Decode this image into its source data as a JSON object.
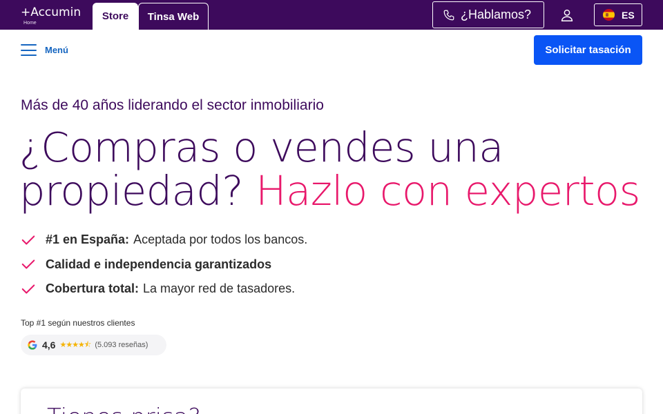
{
  "brand": {
    "logo": "+Accumin",
    "sub": "Home"
  },
  "tabs": [
    {
      "label": "Store",
      "active": true
    },
    {
      "label": "Tinsa Web",
      "active": false
    }
  ],
  "header": {
    "contact_label": "¿Hablamos?",
    "contact_icon": "phone-icon",
    "user_icon": "user-icon",
    "language": "ES",
    "language_flag": "spain-flag-icon"
  },
  "nav": {
    "menu_label": "Menú",
    "cta_label": "Solicitar tasación"
  },
  "hero": {
    "eyebrow": "Más de 40 años liderando el sector inmobiliario",
    "headline_line1": "¿Compras o vendes una",
    "headline_line2": "propiedad?",
    "headline_accent": "Hazlo con expertos",
    "bullets": [
      {
        "bold": "#1 en España:",
        "text": "Aceptada por todos los bancos."
      },
      {
        "bold": "Calidad e independencia garantizados",
        "text": ""
      },
      {
        "bold": "Cobertura total:",
        "text": "La mayor red de tasadores."
      }
    ]
  },
  "rating": {
    "label": "Top #1 según nuestros clientes",
    "score": "4,6",
    "stars": "★★★★⯪",
    "reviews": "(5.093 reseñas)",
    "provider_icon": "google-icon"
  },
  "card": {
    "title": "Tienes prisa?"
  },
  "colors": {
    "topbar": "#3d0a5c",
    "accent": "#e8186b",
    "primary_button": "#0a55f5",
    "menu_link": "#1565c0"
  }
}
